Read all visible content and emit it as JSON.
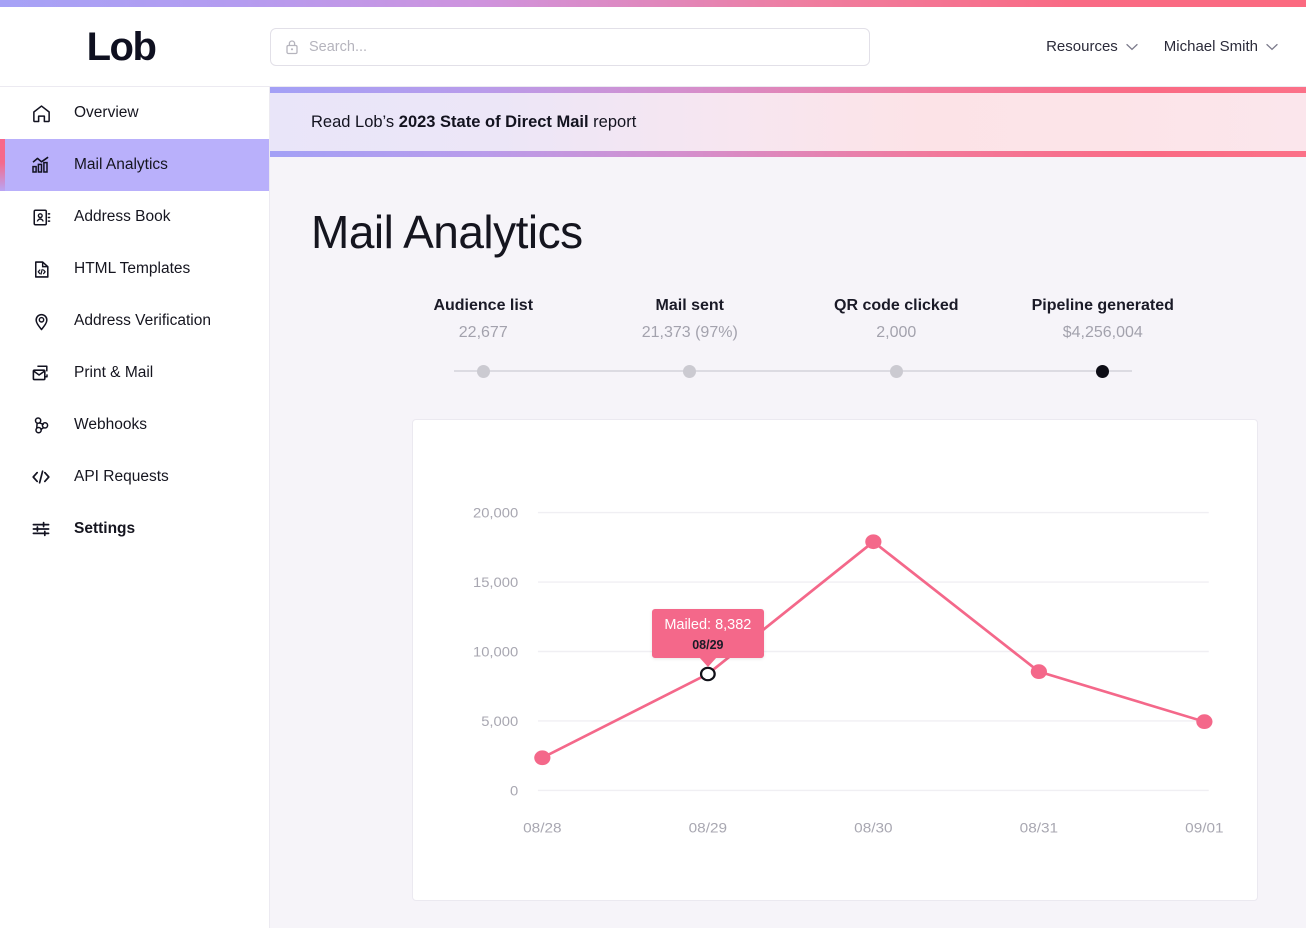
{
  "brand": {
    "logo_text": "Lob",
    "accent_pink": "#f4688a",
    "accent_purple": "#b9b0fb"
  },
  "header": {
    "search": {
      "placeholder": "Search...",
      "value": "",
      "icon": "lock-icon"
    },
    "resources_label": "Resources",
    "account_label": "Michael Smith"
  },
  "sidebar": {
    "items": [
      {
        "label": "Overview",
        "icon": "home-icon",
        "active": false,
        "bold": false
      },
      {
        "label": "Mail Analytics",
        "icon": "bar-chart-icon",
        "active": true,
        "bold": false
      },
      {
        "label": "Address Book",
        "icon": "contact-card-icon",
        "active": false,
        "bold": false
      },
      {
        "label": "HTML Templates",
        "icon": "code-file-icon",
        "active": false,
        "bold": false
      },
      {
        "label": "Address Verification",
        "icon": "map-pin-icon",
        "active": false,
        "bold": false
      },
      {
        "label": "Print & Mail",
        "icon": "printer-mail-icon",
        "active": false,
        "bold": false
      },
      {
        "label": "Webhooks",
        "icon": "webhook-icon",
        "active": false,
        "bold": false
      },
      {
        "label": "API Requests",
        "icon": "code-brackets-icon",
        "active": false,
        "bold": false
      },
      {
        "label": "Settings",
        "icon": "sliders-icon",
        "active": false,
        "bold": true
      }
    ]
  },
  "banner": {
    "prefix": "Read Lob’s ",
    "strong": "2023 State of Direct Mail",
    "suffix": " report"
  },
  "main": {
    "title": "Mail Analytics",
    "metrics": [
      {
        "label": "Audience list",
        "value": "22,677",
        "state": "inactive"
      },
      {
        "label": "Mail sent",
        "value": "21,373 (97%)",
        "state": "inactive"
      },
      {
        "label": "QR code clicked",
        "value": "2,000",
        "state": "inactive"
      },
      {
        "label": "Pipeline generated",
        "value": "$4,256,004",
        "state": "active"
      }
    ]
  },
  "chart_data": {
    "type": "line",
    "title": "",
    "xlabel": "",
    "ylabel": "",
    "x": [
      "08/28",
      "08/29",
      "08/30",
      "08/31",
      "09/01"
    ],
    "categories": [
      "08/28",
      "08/29",
      "08/30",
      "08/31",
      "09/01"
    ],
    "series": [
      {
        "name": "Mailed",
        "values": [
          2350,
          8382,
          17900,
          8550,
          4950
        ],
        "color": "#f4688a"
      }
    ],
    "values": [
      2350,
      8382,
      17900,
      8550,
      4950
    ],
    "ylim": [
      0,
      21500
    ],
    "yticks": [
      0,
      5000,
      10000,
      15000,
      20000
    ],
    "ytick_labels": [
      "0",
      "5,000",
      "10,000",
      "15,000",
      "20,000"
    ],
    "grid": true,
    "legend": "none",
    "hover_point": {
      "index": 1,
      "label": "Mailed: 8,382",
      "date": "08/29",
      "value": 8382
    }
  }
}
